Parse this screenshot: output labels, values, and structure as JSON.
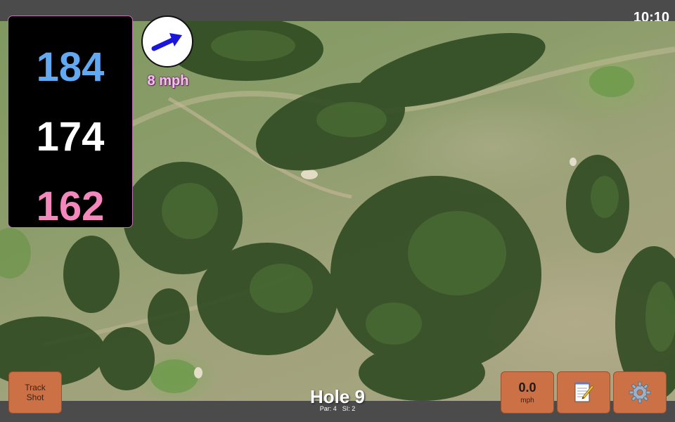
{
  "status_bar": {
    "time": "10:10"
  },
  "distances": {
    "back": "184",
    "middle": "174",
    "front": "162"
  },
  "wind": {
    "speed": "8 mph",
    "icon": "wind-direction-arrow-icon"
  },
  "hole": {
    "title": "Hole 9",
    "par": "Par: 4",
    "si": "SI: 2"
  },
  "buttons": {
    "track_shot": "Track Shot",
    "speed_value": "0.0",
    "speed_unit": "mph",
    "notes_icon": "notepad-icon",
    "settings_icon": "gear-icon"
  },
  "colors": {
    "back_distance": "#62a9f2",
    "middle_distance": "#ffffff",
    "front_distance": "#f487bb",
    "button_accent": "#cc7045",
    "wind_arrow": "#1a16d9"
  }
}
